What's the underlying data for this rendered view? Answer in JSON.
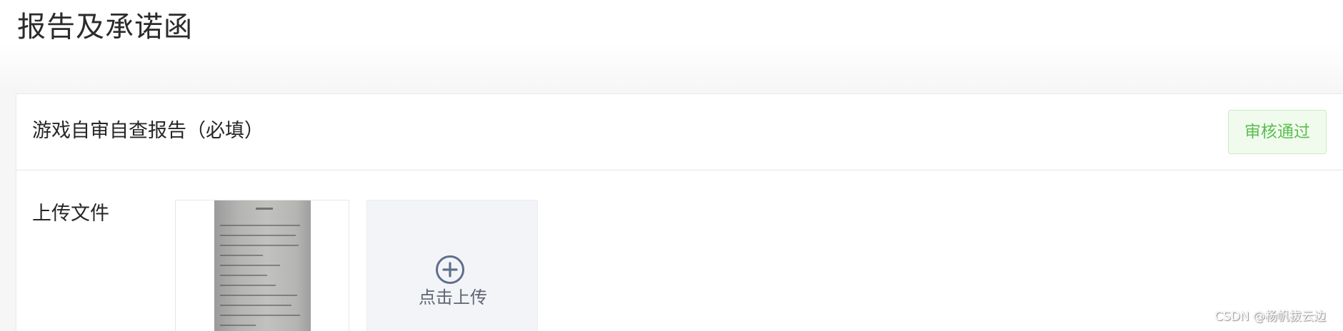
{
  "page": {
    "title": "报告及承诺函"
  },
  "section": {
    "title": "游戏自审自查报告（必填）",
    "status": "审核通过",
    "status_color": "#5cbe4e"
  },
  "upload": {
    "label": "上传文件",
    "button_label": "点击上传",
    "button_icon": "plus-circle-icon",
    "files": [
      {
        "type": "image",
        "icon": "document-photo"
      }
    ]
  },
  "watermark": "CSDN @杨帆拔云边"
}
